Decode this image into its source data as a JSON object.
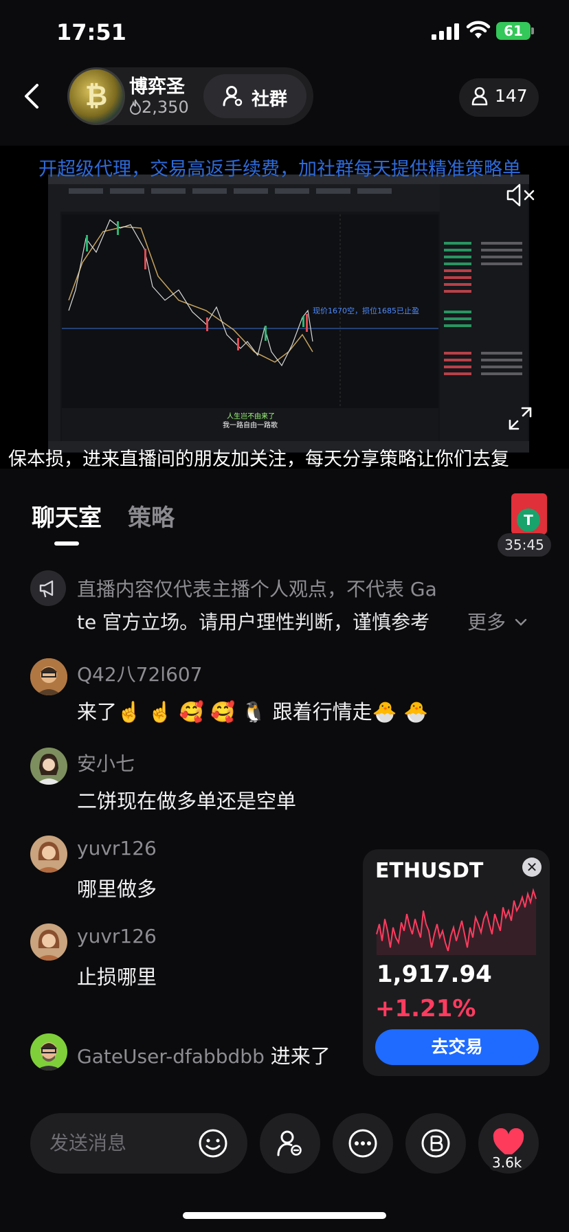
{
  "status_bar": {
    "time": "17:51",
    "battery": "61"
  },
  "header": {
    "host_name": "博弈圣",
    "host_heat": "2,350",
    "community_label": "社群",
    "viewer_count": "147"
  },
  "stream": {
    "ticker_top": "开超级代理，交易高返手续费，加社群每天提供精准策略单",
    "ticker_bottom": "保本损，进来直播间的朋友加关注，每天分享策略让你们去复",
    "chart_annotation": "现价1670空，损位1685已止盈",
    "subtitle_1": "人生岂不由来了",
    "subtitle_2": "我一路自由一路歌"
  },
  "tabs": [
    {
      "label": "聊天室",
      "active": true
    },
    {
      "label": "策略",
      "active": false
    }
  ],
  "timer": "35:45",
  "notice": {
    "line1": "直播内容仅代表主播个人观点，不代表 Ga",
    "line2": "te 官方立场。请用户理性判断，谨慎参考",
    "more": "更多"
  },
  "chat": [
    {
      "user": "Q42八72l607",
      "message": "来了☝️ ☝️ 🥰 🥰 🐧 跟着行情走🐣 🐣"
    },
    {
      "user": "安小七",
      "message": "二饼现在做多单还是空单"
    },
    {
      "user": "yuvr126",
      "message": "哪里做多"
    },
    {
      "user": "yuvr126",
      "message": "止损哪里"
    },
    {
      "user": "GateUser-dfabbdbb",
      "message": "进来了"
    }
  ],
  "eth_card": {
    "symbol": "ETHUSDT",
    "price": "1,917.94",
    "change": "+1.21%",
    "trade_label": "去交易",
    "sparkline": [
      38,
      44,
      34,
      47,
      40,
      30,
      42,
      36,
      33,
      45,
      40,
      50,
      43,
      38,
      47,
      41,
      36,
      52,
      44,
      40,
      30,
      38,
      44,
      36,
      40,
      33,
      28,
      37,
      42,
      34,
      40,
      46,
      38,
      30,
      42,
      36,
      48,
      44,
      39,
      47,
      51,
      44,
      38,
      50,
      45,
      40,
      54,
      48,
      52,
      46,
      58,
      52,
      55,
      60,
      54,
      62,
      57,
      64,
      59
    ]
  },
  "bottom_bar": {
    "input_placeholder": "发送消息",
    "like_count": "3.6k"
  },
  "colors": {
    "background": "#0b0b0d",
    "accent_blue": "#1f6bff",
    "price_up": "#ff3c5f",
    "like_red": "#ff3b5c",
    "ticker_blue": "#2f6ad8"
  }
}
